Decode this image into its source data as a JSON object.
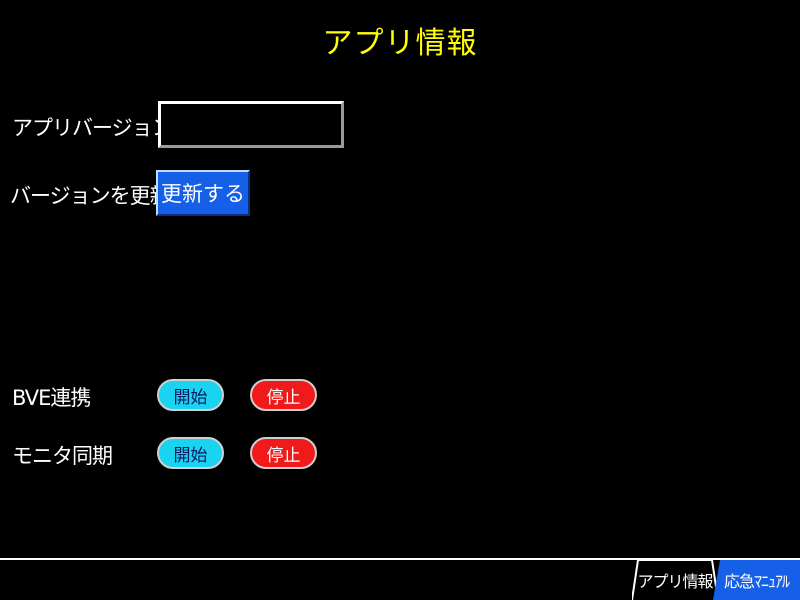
{
  "header": {
    "title": "アプリ情報"
  },
  "version": {
    "label": "アプリバージョン",
    "value": "",
    "placeholder": ""
  },
  "update": {
    "label": "バージョンを更新",
    "button_label": "更新する"
  },
  "controls": [
    {
      "label": "BVE連携",
      "start_label": "開始",
      "stop_label": "停止"
    },
    {
      "label": "モニタ同期",
      "start_label": "開始",
      "stop_label": "停止"
    }
  ],
  "tabs": [
    {
      "label": "アプリ情報",
      "active": true
    },
    {
      "label": "応急ﾏﾆｭｱﾙ",
      "active": false
    }
  ],
  "colors": {
    "background": "#000000",
    "title": "#ffff00",
    "update_button": "#1560e6",
    "start_button": "#19d3f0",
    "stop_button": "#f01a1a",
    "active_tab_alt": "#1560e6"
  }
}
